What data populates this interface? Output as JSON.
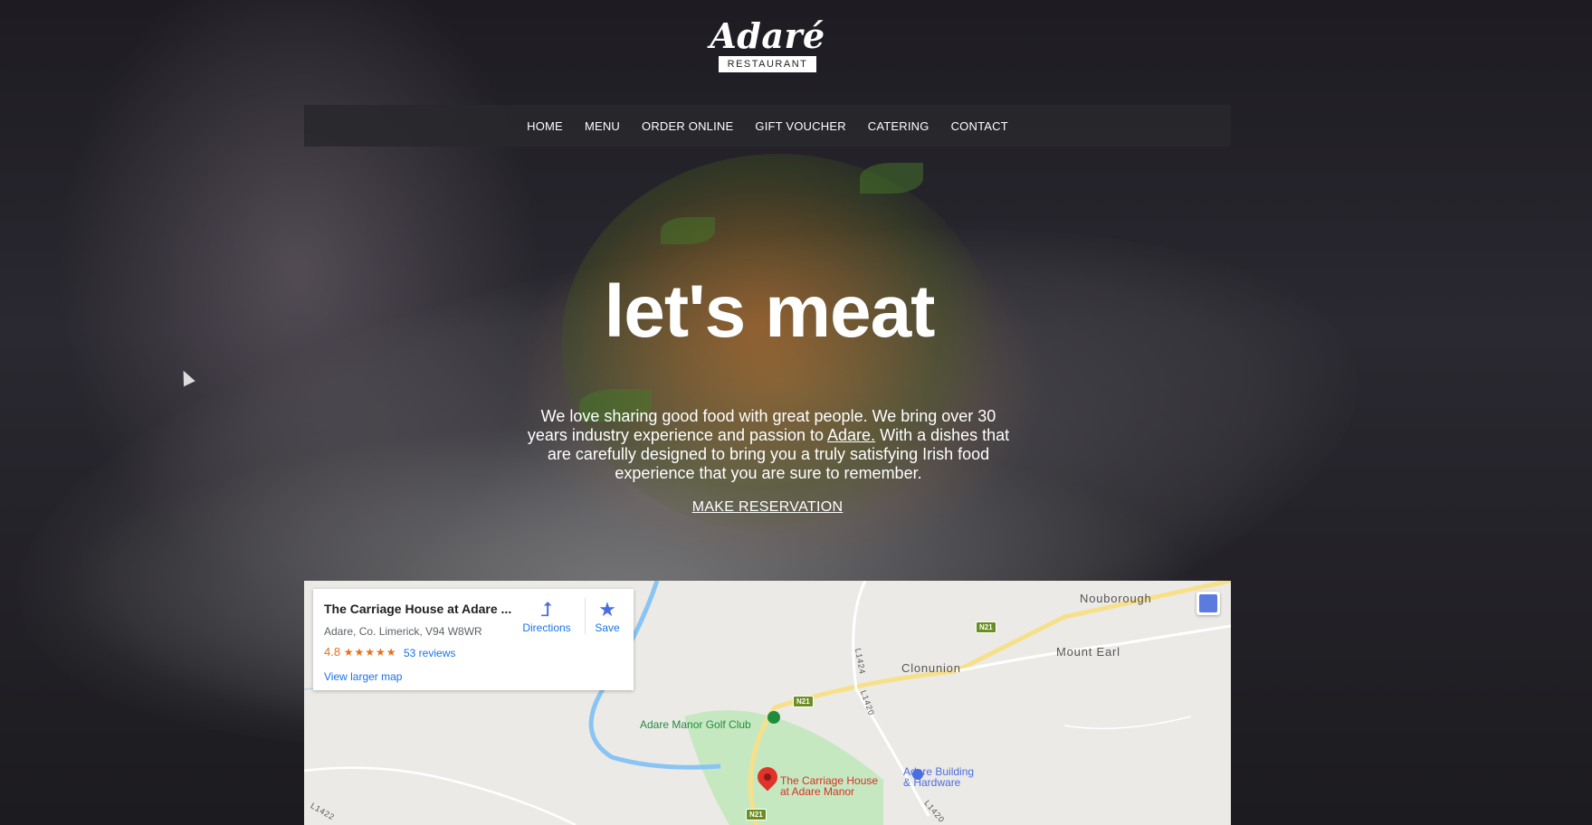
{
  "brand": {
    "logo_word": "Adaré",
    "logo_sub": "RESTAURANT"
  },
  "nav": {
    "items": [
      "HOME",
      "MENU",
      "ORDER ONLINE",
      "GIFT VOUCHER",
      "CATERING",
      "CONTACT"
    ]
  },
  "hero": {
    "title": "let's meat",
    "text_before": "We love sharing good food with great people. We bring over 30 years industry experience and passion to ",
    "text_link": "Adare.",
    "text_after": " With a dishes that are carefully designed to bring you a truly satisfying Irish food experience that you are sure to remember.",
    "cta": "MAKE RESERVATION"
  },
  "map": {
    "card": {
      "title": "The Carriage House at Adare ...",
      "address": "Adare, Co. Limerick, V94 W8WR",
      "rating": "4.8",
      "stars": "★★★★★",
      "reviews": "53 reviews",
      "larger_map": "View larger map",
      "directions": "Directions",
      "save": "Save",
      "directions_icon": "directions-icon",
      "save_icon": "star-icon"
    },
    "places": {
      "nouborough": "Nouborough",
      "mount_earl": "Mount Earl",
      "clonunion": "Clonunion",
      "golf_club": "Adare Manor Golf Club",
      "carriage_house_1": "The Carriage House",
      "carriage_house_2": "at Adare Manor",
      "building_1": "Adare Building",
      "building_2": "& Hardware"
    },
    "roads": {
      "n21_a": "N21",
      "n21_b": "N21",
      "n21_c": "N21",
      "l1424": "L1424",
      "l1420_a": "L1420",
      "l1420_b": "L1420",
      "l1422": "L1422"
    },
    "colors": {
      "park": "#c6e8c1",
      "water": "#89c4f4",
      "road_major": "#f7e08a",
      "pin": "#e0332a"
    }
  }
}
